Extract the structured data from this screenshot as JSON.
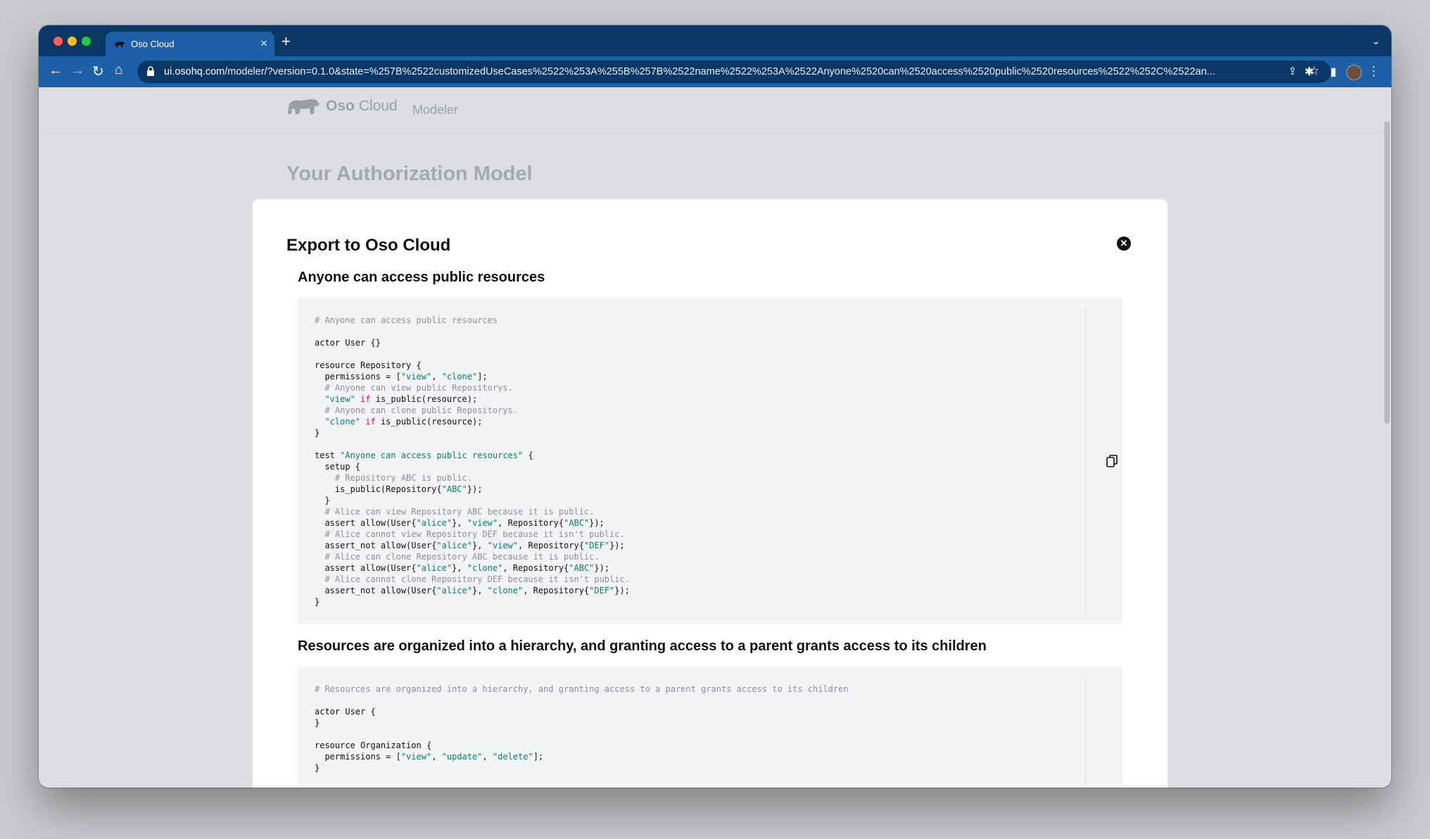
{
  "browser": {
    "tab_title": "Oso Cloud",
    "url_host": "ui.osohq.com",
    "url_rest": "/modeler/?version=0.1.0&state=%257B%2522customizedUseCases%2522%253A%255B%257B%2522name%2522%253A%2522Anyone%2520can%2520access%2520public%2520resources%2522%252C%2522an...",
    "icons": [
      "back-icon",
      "forward-icon",
      "reload-icon",
      "home-icon",
      "lock-icon",
      "share-icon",
      "star-icon",
      "puzzle-icon",
      "sidepanel-icon",
      "menu-icon"
    ]
  },
  "header": {
    "logo_oso": "Oso",
    "logo_cloud": "Cloud",
    "nav_modeler": "Modeler"
  },
  "page": {
    "title": "Your Authorization Model"
  },
  "modal": {
    "title": "Export to Oso Cloud",
    "close_icon": "✕",
    "sections": [
      {
        "title": "Anyone can access public resources",
        "code": [
          [
            [
              "cm",
              "# Anyone can access public resources"
            ]
          ],
          [],
          [
            [
              "",
              "actor User {}"
            ]
          ],
          [],
          [
            [
              "",
              "resource Repository {"
            ]
          ],
          [
            [
              "",
              "  permissions = ["
            ],
            [
              "st",
              "\"view\""
            ],
            [
              "",
              ", "
            ],
            [
              "st",
              "\"clone\""
            ],
            [
              "",
              "];"
            ]
          ],
          [
            [
              "cm",
              "  # Anyone can view public Repositorys."
            ]
          ],
          [
            [
              "",
              "  "
            ],
            [
              "st",
              "\"view\""
            ],
            [
              "kw",
              " if"
            ],
            [
              "",
              " is_public(resource);"
            ]
          ],
          [
            [
              "cm",
              "  # Anyone can clone public Repositorys."
            ]
          ],
          [
            [
              "",
              "  "
            ],
            [
              "st",
              "\"clone\""
            ],
            [
              "kw",
              " if"
            ],
            [
              "",
              " is_public(resource);"
            ]
          ],
          [
            [
              "",
              "}"
            ]
          ],
          [],
          [
            [
              "",
              "test "
            ],
            [
              "st",
              "\"Anyone can access public resources\""
            ],
            [
              "",
              " {"
            ]
          ],
          [
            [
              "",
              "  setup {"
            ]
          ],
          [
            [
              "cm",
              "    # Repository ABC is public."
            ]
          ],
          [
            [
              "",
              "    is_public(Repository{"
            ],
            [
              "st",
              "\"ABC\""
            ],
            [
              "",
              "});"
            ]
          ],
          [
            [
              "",
              "  }"
            ]
          ],
          [
            [
              "cm",
              "  # Alice can view Repository ABC because it is public."
            ]
          ],
          [
            [
              "",
              "  assert allow(User{"
            ],
            [
              "st",
              "\"alice\""
            ],
            [
              "",
              "}, "
            ],
            [
              "st",
              "\"view\""
            ],
            [
              "",
              ", Repository{"
            ],
            [
              "st",
              "\"ABC\""
            ],
            [
              "",
              "});"
            ]
          ],
          [
            [
              "cm",
              "  # Alice cannot view Repository DEF because it isn't public."
            ]
          ],
          [
            [
              "",
              "  assert_not allow(User{"
            ],
            [
              "st",
              "\"alice\""
            ],
            [
              "",
              "}, "
            ],
            [
              "st",
              "\"view\""
            ],
            [
              "",
              ", Repository{"
            ],
            [
              "st",
              "\"DEF\""
            ],
            [
              "",
              "});"
            ]
          ],
          [
            [
              "cm",
              "  # Alice can clone Repository ABC because it is public."
            ]
          ],
          [
            [
              "",
              "  assert allow(User{"
            ],
            [
              "st",
              "\"alice\""
            ],
            [
              "",
              "}, "
            ],
            [
              "st",
              "\"clone\""
            ],
            [
              "",
              ", Repository{"
            ],
            [
              "st",
              "\"ABC\""
            ],
            [
              "",
              "});"
            ]
          ],
          [
            [
              "cm",
              "  # Alice cannot clone Repository DEF because it isn't public."
            ]
          ],
          [
            [
              "",
              "  assert_not allow(User{"
            ],
            [
              "st",
              "\"alice\""
            ],
            [
              "",
              "}, "
            ],
            [
              "st",
              "\"clone\""
            ],
            [
              "",
              ", Repository{"
            ],
            [
              "st",
              "\"DEF\""
            ],
            [
              "",
              "});"
            ]
          ],
          [
            [
              "",
              "}"
            ]
          ]
        ]
      },
      {
        "title": "Resources are organized into a hierarchy, and granting access to a parent grants access to its children",
        "code": [
          [
            [
              "cm",
              "# Resources are organized into a hierarchy, and granting access to a parent grants access to its children"
            ]
          ],
          [],
          [
            [
              "",
              "actor User {"
            ]
          ],
          [
            [
              "",
              "}"
            ]
          ],
          [],
          [
            [
              "",
              "resource Organization {"
            ]
          ],
          [
            [
              "",
              "  permissions = ["
            ],
            [
              "st",
              "\"view\""
            ],
            [
              "",
              ", "
            ],
            [
              "st",
              "\"update\""
            ],
            [
              "",
              ", "
            ],
            [
              "st",
              "\"delete\""
            ],
            [
              "",
              "];"
            ]
          ],
          [
            [
              "",
              "}"
            ]
          ]
        ]
      }
    ]
  }
}
